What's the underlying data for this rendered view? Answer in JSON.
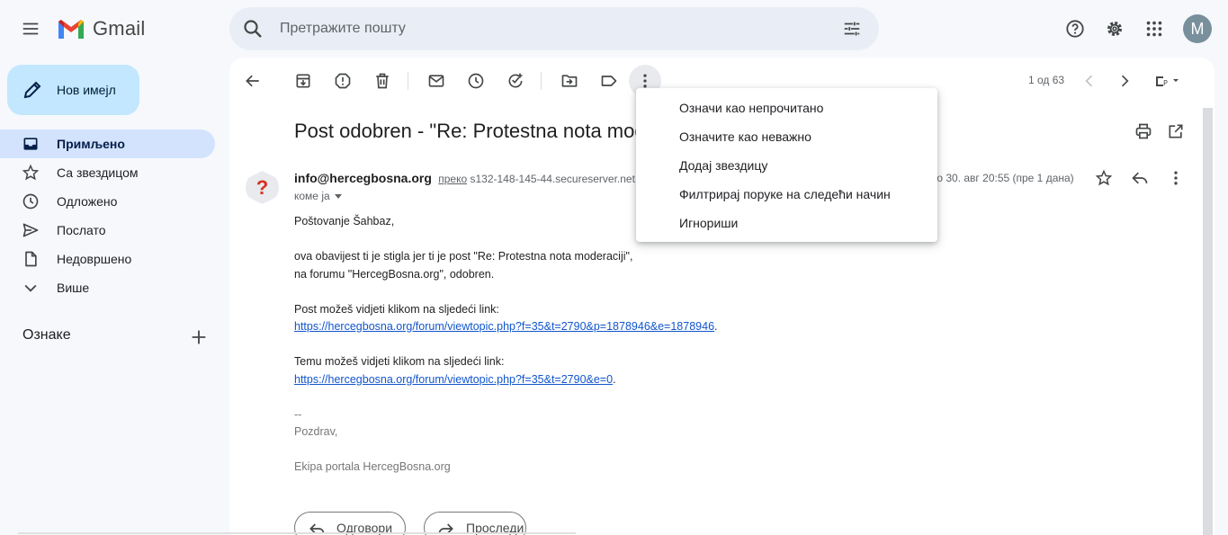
{
  "header": {
    "app_name": "Gmail",
    "search_placeholder": "Претражите пошту",
    "avatar_initial": "M"
  },
  "sidebar": {
    "compose_label": "Нов имејл",
    "items": [
      {
        "label": "Примљено",
        "icon": "inbox-icon",
        "active": true
      },
      {
        "label": "Са звездицом",
        "icon": "star-icon"
      },
      {
        "label": "Одложено",
        "icon": "clock-icon"
      },
      {
        "label": "Послато",
        "icon": "send-icon"
      },
      {
        "label": "Недовршено",
        "icon": "draft-icon"
      },
      {
        "label": "Више",
        "icon": "chevron-down-icon"
      }
    ],
    "labels_heading": "Ознаке"
  },
  "toolbar": {
    "pager": "1 од 63"
  },
  "email": {
    "subject": "Post odobren - \"Re: Protestna nota moderaciji\"",
    "sender_name": "info@hercegbosna.org",
    "via_label": "преко",
    "via_server": "s132-148-145-44.secureserver.net",
    "date": "то 30. авг 20:55 (пре 1 дана)",
    "to_label": "коме ја",
    "greeting": "Poštovanje Šahbaz,",
    "line1": "ova obavijest ti je stigla jer ti je post \"Re: Protestna nota moderaciji\",",
    "line2": "na forumu \"HercegBosna.org\", odobren.",
    "post_link_intro": "Post možeš vidjeti klikom na sljedeći link:",
    "post_link": "https://hercegbosna.org/forum/viewtopic.php?f=35&t=2790&p=1878946&e=1878946",
    "topic_link_intro": "Temu možeš vidjeti klikom na sljedeći link:",
    "topic_link": "https://hercegbosna.org/forum/viewtopic.php?f=35&t=2790&e=0",
    "sig_dashes": "--",
    "sig_greeting": "Pozdrav,",
    "sig_team": "Ekipa portala HercegBosna.org",
    "trailing_dot": "."
  },
  "actions": {
    "reply": "Одговори",
    "forward": "Проследи"
  },
  "dropdown": {
    "items": [
      "Означи као непрочитано",
      "Означите као неважно",
      "Додај звездицу",
      "Филтрирај поруке на следећи начин",
      "Игнориши"
    ]
  },
  "colors": {
    "accent": "#c2e7ff",
    "active_nav": "#d3e3fd",
    "link": "#1155cc"
  }
}
